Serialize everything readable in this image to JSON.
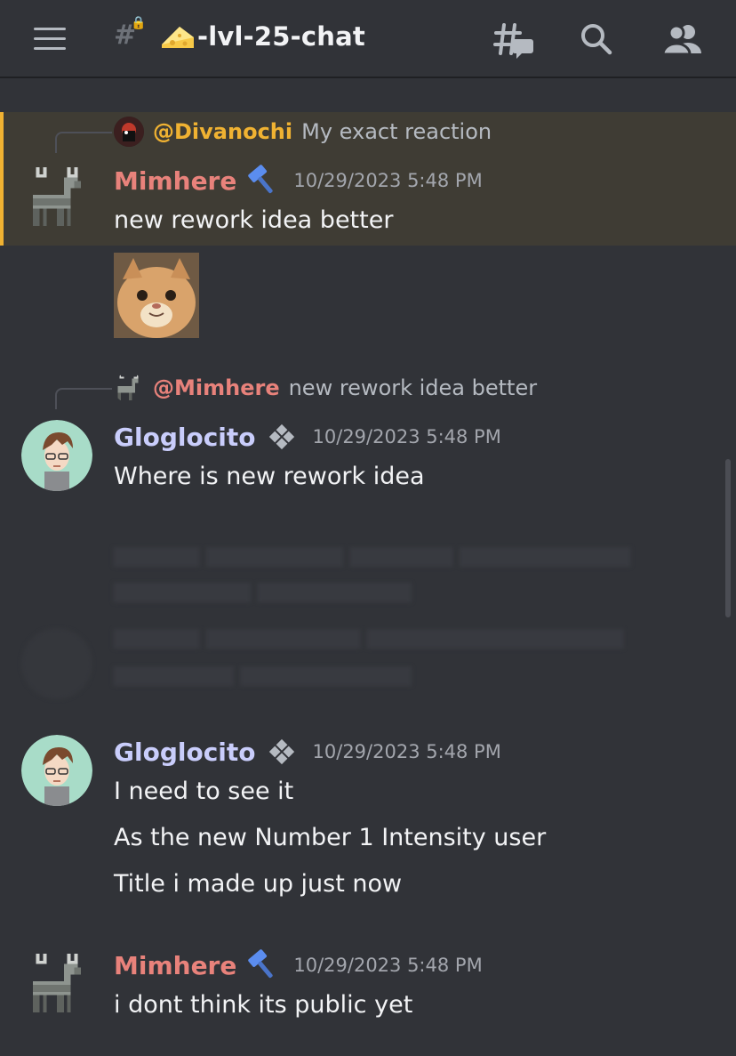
{
  "header": {
    "channel_emoji": "cheese-wedge",
    "channel_name": "-lvl-25-chat",
    "icons": [
      "hamburger-menu-icon",
      "locked-channel-icon",
      "threads-icon",
      "search-icon",
      "members-icon"
    ]
  },
  "colors": {
    "background": "#313338",
    "highlight_bg": "#3f3c34",
    "highlight_bar": "#f0b232",
    "mimhere_name": "#e8827b",
    "gloglocito_name": "#c9cdfb",
    "divanochi_mention": "#f0b232",
    "timestamp": "#a3a6ad"
  },
  "messages": [
    {
      "reply": {
        "mention": "@Divanochi",
        "snippet": "My exact reaction"
      },
      "author": "Mimhere",
      "badge": "hammer-icon",
      "timestamp": "10/29/2023 5:48 PM",
      "lines": [
        "new rework idea better"
      ],
      "attachment": "cat-image"
    },
    {
      "reply": {
        "mention": "@Mimhere",
        "snippet": "new rework idea better"
      },
      "author": "Gloglocito",
      "badge": "diamond-icon",
      "timestamp": "10/29/2023 5:48 PM",
      "lines": [
        "Where is new rework idea"
      ]
    },
    {
      "author": "Gloglocito",
      "badge": "diamond-icon",
      "timestamp": "10/29/2023 5:48 PM",
      "lines": [
        "I need to see it",
        "As the new Number 1 Intensity user",
        "Title i made up just now"
      ]
    },
    {
      "author": "Mimhere",
      "badge": "hammer-icon",
      "timestamp": "10/29/2023 5:48 PM",
      "lines": [
        "i dont think its public yet"
      ]
    }
  ]
}
